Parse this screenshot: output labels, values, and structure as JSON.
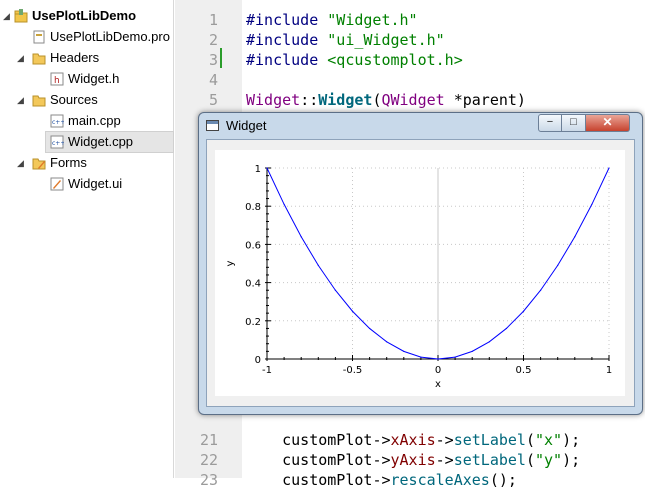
{
  "tree": {
    "project": "UsePlotLibDemo",
    "pro_file": "UsePlotLibDemo.pro",
    "headers": "Headers",
    "header_file": "Widget.h",
    "sources": "Sources",
    "source_files": [
      "main.cpp",
      "Widget.cpp"
    ],
    "forms": "Forms",
    "form_file": "Widget.ui",
    "selected": "Widget.cpp"
  },
  "editor": {
    "line_numbers": [
      "1",
      "2",
      "3",
      "4",
      "5",
      "21",
      "22",
      "23"
    ],
    "code": {
      "l1_directive": "#include",
      "l1_value": "\"Widget.h\"",
      "l2_directive": "#include",
      "l2_value": "\"ui_Widget.h\"",
      "l3_directive": "#include",
      "l3_value": "<qcustomplot.h>",
      "l5_class": "Widget",
      "l5_scope": "::",
      "l5_func": "Widget",
      "l5_paren": "(",
      "l5_type": "QWidget",
      "l5_arg": " *parent)",
      "l21_obj": "customPlot",
      "l21_arrow": "->",
      "l21_member": "xAxis",
      "l21_arrow2": "->",
      "l21_call": "setLabel",
      "l21_open": "(",
      "l21_str": "\"x\"",
      "l21_close": ");",
      "l22_obj": "customPlot",
      "l22_arrow": "->",
      "l22_member": "yAxis",
      "l22_arrow2": "->",
      "l22_call": "setLabel",
      "l22_open": "(",
      "l22_str": "\"y\"",
      "l22_close": ");",
      "l23_obj": "customPlot",
      "l23_arrow": "->",
      "l23_call": "rescaleAxes",
      "l23_close": "();"
    }
  },
  "window": {
    "title": "Widget",
    "min_glyph": "−",
    "max_glyph": "□",
    "close_glyph": "✕"
  },
  "colors": {
    "curve": "#0000ff",
    "zero_line": "#c8c8c8",
    "grid": "#c8c8c8"
  },
  "chart_data": {
    "type": "line",
    "title": "",
    "xlabel": "x",
    "ylabel": "y",
    "xlim": [
      -1,
      1
    ],
    "ylim": [
      0,
      1
    ],
    "xticks": [
      "-1",
      "-0.5",
      "0",
      "0.5",
      "1"
    ],
    "yticks": [
      "0",
      "0.2",
      "0.4",
      "0.6",
      "0.8",
      "1"
    ],
    "grid": true,
    "series": [
      {
        "x": [
          -1,
          -0.9,
          -0.8,
          -0.7,
          -0.6,
          -0.5,
          -0.4,
          -0.3,
          -0.2,
          -0.1,
          0,
          0.1,
          0.2,
          0.3,
          0.4,
          0.5,
          0.6,
          0.7,
          0.8,
          0.9,
          1
        ],
        "values": [
          1,
          0.81,
          0.64,
          0.49,
          0.36,
          0.25,
          0.16,
          0.09,
          0.04,
          0.01,
          0,
          0.01,
          0.04,
          0.09,
          0.16,
          0.25,
          0.36,
          0.49,
          0.64,
          0.81,
          1
        ]
      }
    ]
  }
}
